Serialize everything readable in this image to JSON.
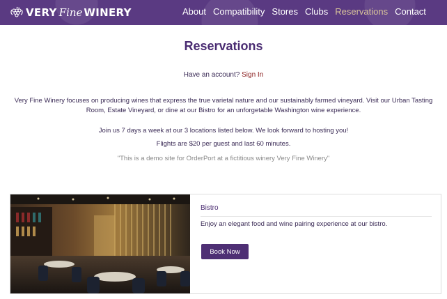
{
  "brand": {
    "logo_word1": "VERY",
    "logo_word2": "Fine",
    "logo_word3": "WINERY",
    "icon": "grape-cluster-icon"
  },
  "nav": {
    "items": [
      {
        "label": "About"
      },
      {
        "label": "Compatibility"
      },
      {
        "label": "Stores"
      },
      {
        "label": "Clubs"
      },
      {
        "label": "Reservations",
        "active": true
      },
      {
        "label": "Contact"
      }
    ]
  },
  "page": {
    "title": "Reservations",
    "account_prompt": "Have an account?",
    "sign_in_label": "Sign In",
    "intro": "Very Fine Winery focuses on producing wines that express the true varietal nature and our sustainably farmed vineyard. Visit our Urban Tasting Room, Estate Vineyard, or dine at our Bistro for an unforgetable Washington wine experience.",
    "join": "Join us 7 days a week at our 3 locations listed below. We look forward to hosting you!",
    "flights": "Flights are $20 per guest and last 60 minutes.",
    "demo_note": "\"This is a demo site for OrderPort at a fictitious winery Very Fine Winery\""
  },
  "reservation_card": {
    "title": "Bistro",
    "description": "Enjoy an elegant food and wine pairing experience at our bistro.",
    "button_label": "Book Now",
    "image": "restaurant-interior-photo"
  },
  "colors": {
    "header_bg": "#5a3a82",
    "accent": "#4e2f74",
    "nav_active": "#d9c49a",
    "link": "#8a1e1e"
  }
}
